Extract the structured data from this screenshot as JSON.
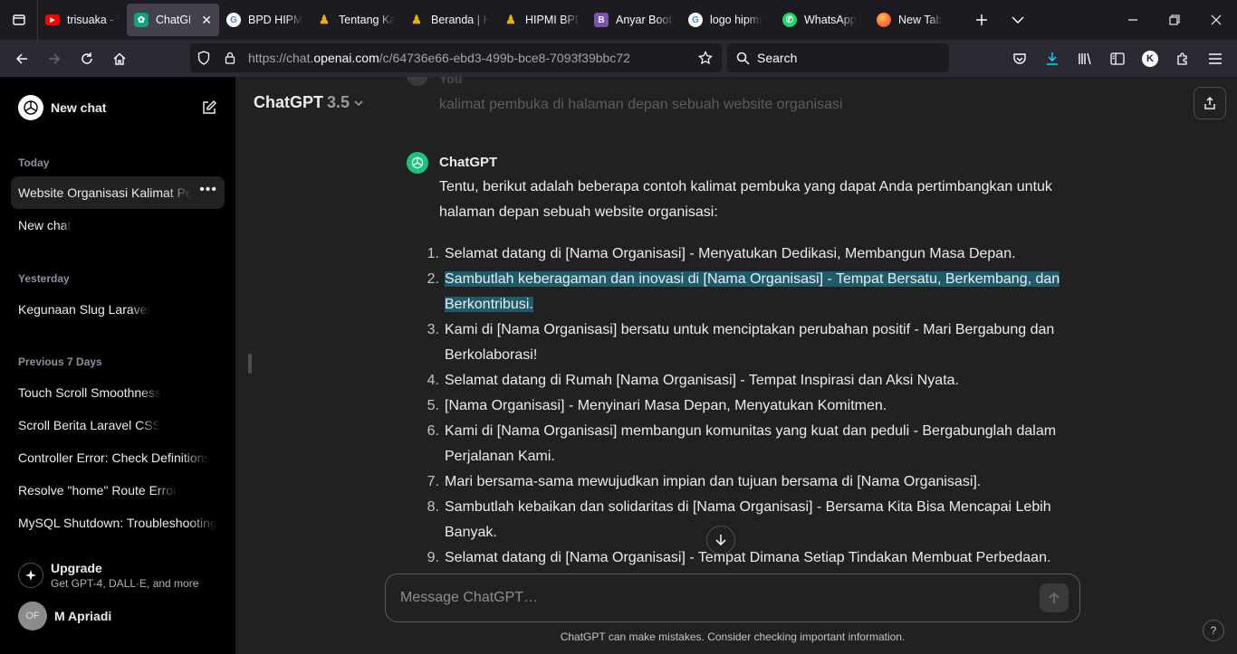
{
  "browser": {
    "tabs": [
      {
        "label": "trisuaka - Yo",
        "icon": "youtube-icon",
        "color": "#ff0000"
      },
      {
        "label": "ChatGPT",
        "icon": "chatgpt-icon",
        "color": "#10a37f",
        "active": true
      },
      {
        "label": "BPD HIPMI",
        "icon": "google-icon",
        "color": "#ffffff"
      },
      {
        "label": "Tentang Kam",
        "icon": "hipmi-icon",
        "color": "#e8b400"
      },
      {
        "label": "Beranda | HI",
        "icon": "hipmi-icon",
        "color": "#e8b400"
      },
      {
        "label": "HIPMI BPD",
        "icon": "hipmi-icon",
        "color": "#e8b400"
      },
      {
        "label": "Anyar Boots",
        "icon": "bootstrap-icon",
        "color": "#7952b3"
      },
      {
        "label": "logo hipmi",
        "icon": "google-icon",
        "color": "#ffffff"
      },
      {
        "label": "WhatsApp",
        "icon": "whatsapp-icon",
        "color": "#25d366"
      },
      {
        "label": "New Tab",
        "icon": "firefox-icon",
        "color": "#ff7139"
      }
    ],
    "url_prefix": "https://chat.",
    "url_host": "openai.com",
    "url_path": "/c/64736e66-ebd3-499b-bce8-7093f39bbc72",
    "search_placeholder": "Search",
    "profile_initial": "K"
  },
  "sidebar": {
    "new_chat": "New chat",
    "sections": [
      {
        "title": "Today",
        "items": [
          "Website Organisasi Kalimat Pembuka",
          "New chat"
        ]
      },
      {
        "title": "Yesterday",
        "items": [
          "Kegunaan Slug Laravel"
        ]
      },
      {
        "title": "Previous 7 Days",
        "items": [
          "Touch Scroll Smoothness",
          "Scroll Berita Laravel CSS",
          "Controller Error: Check Definitions",
          "Resolve \"home\" Route Error",
          "MySQL Shutdown: Troubleshooting"
        ]
      }
    ],
    "upgrade_title": "Upgrade",
    "upgrade_sub": "Get GPT-4, DALL·E, and more",
    "user_initials": "OF",
    "user_name": "M Apriadi"
  },
  "main": {
    "model_name": "ChatGPT",
    "model_version": "3.5",
    "prev_user_label": "You",
    "prev_user_message": "kalimat pembuka di halaman depan sebuah website organisasi",
    "author": "ChatGPT",
    "intro": "Tentu, berikut adalah beberapa contoh kalimat pembuka yang dapat Anda pertimbangkan untuk halaman depan sebuah website organisasi:",
    "answers": [
      {
        "num": "1.",
        "text": "Selamat datang di [Nama Organisasi] - Menyatukan Dedikasi, Membangun Masa Depan."
      },
      {
        "num": "2.",
        "text": "Sambutlah keberagaman dan inovasi di [Nama Organisasi] - Tempat Bersatu, Berkembang, dan Berkontribusi.",
        "highlighted": true
      },
      {
        "num": "3.",
        "text": "Kami di [Nama Organisasi] bersatu untuk menciptakan perubahan positif - Mari Bergabung dan Berkolaborasi!"
      },
      {
        "num": "4.",
        "text": "Selamat datang di Rumah [Nama Organisasi] - Tempat Inspirasi dan Aksi Nyata."
      },
      {
        "num": "5.",
        "text": "[Nama Organisasi] - Menyinari Masa Depan, Menyatukan Komitmen."
      },
      {
        "num": "6.",
        "text": "Kami di [Nama Organisasi] membangun komunitas yang kuat dan peduli - Bergabunglah dalam Perjalanan Kami."
      },
      {
        "num": "7.",
        "text": "Mari bersama-sama mewujudkan impian dan tujuan bersama di [Nama Organisasi]."
      },
      {
        "num": "8.",
        "text": "Sambutlah kebaikan dan solidaritas di [Nama Organisasi] - Bersama Kita Bisa Mencapai Lebih Banyak."
      },
      {
        "num": "9.",
        "text": "Selamat datang di [Nama Organisasi] - Tempat Dimana Setiap Tindakan Membuat Perbedaan."
      }
    ],
    "composer_placeholder": "Message ChatGPT…",
    "disclaimer": "ChatGPT can make mistakes. Consider checking important information.",
    "help": "?"
  }
}
